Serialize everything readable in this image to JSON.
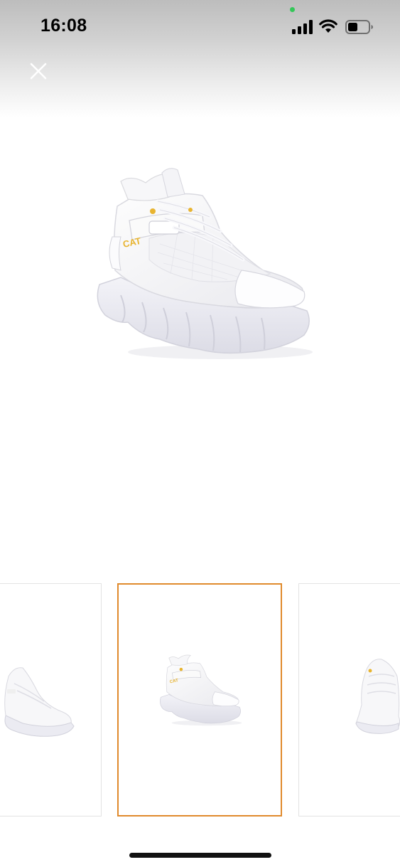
{
  "status_bar": {
    "time": "16:08",
    "signal_icon": "cellular-signal-icon",
    "wifi_icon": "wifi-icon",
    "battery_icon": "battery-icon",
    "privacy_indicator_color": "#34c759"
  },
  "header": {
    "close_icon": "close-icon"
  },
  "gallery": {
    "main_image": "white-high-top-sneaker-photo",
    "selected_index": 2,
    "thumbnails": [
      {
        "image": "sneaker-side-view-thumbnail"
      },
      {
        "image": "sneaker-front-three-quarter-thumbnail"
      },
      {
        "image": "sneaker-rear-view-thumbnail"
      }
    ],
    "selected_border_color": "#e08a2c"
  },
  "colors": {
    "accent_gold": "#e8b430",
    "sole": "#ebebf2"
  }
}
